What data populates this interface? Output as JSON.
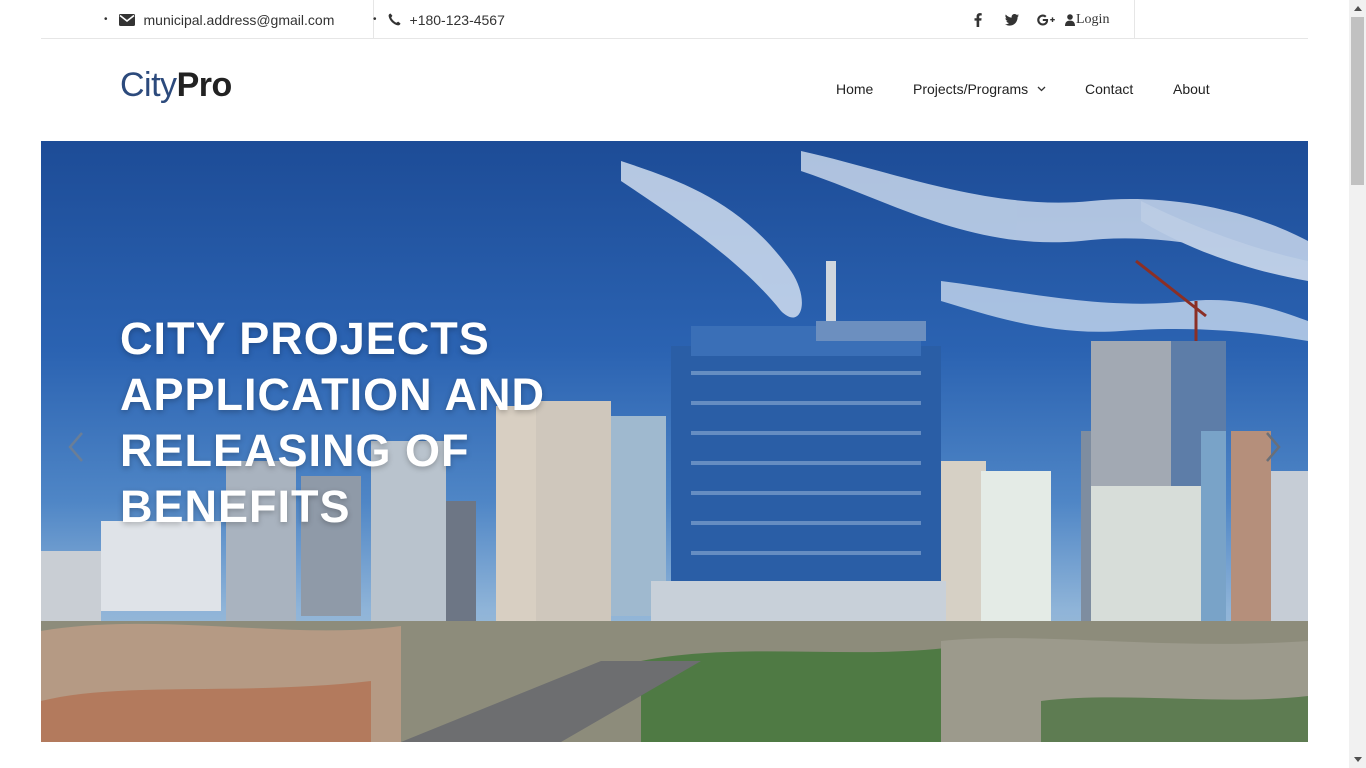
{
  "topbar": {
    "email": "municipal.address@gmail.com",
    "phone": "+180-123-4567",
    "bullet": "•",
    "social": [
      {
        "icon": "facebook-icon",
        "glyph": "f"
      },
      {
        "icon": "twitter-icon",
        "glyph": "🐦"
      },
      {
        "icon": "google-plus-icon",
        "glyph": "G+"
      }
    ],
    "login": "Login"
  },
  "header": {
    "logo_part1": "City",
    "logo_part2": "Pro"
  },
  "nav": {
    "home": "Home",
    "projects": "Projects/Programs",
    "contact": "Contact",
    "about": "About"
  },
  "hero": {
    "title": "CITY PROJECTS APPLICATION AND RELEASING OF BENEFITS"
  },
  "colors": {
    "brand": "#2c4a7c",
    "sky": "#2b63b2"
  }
}
